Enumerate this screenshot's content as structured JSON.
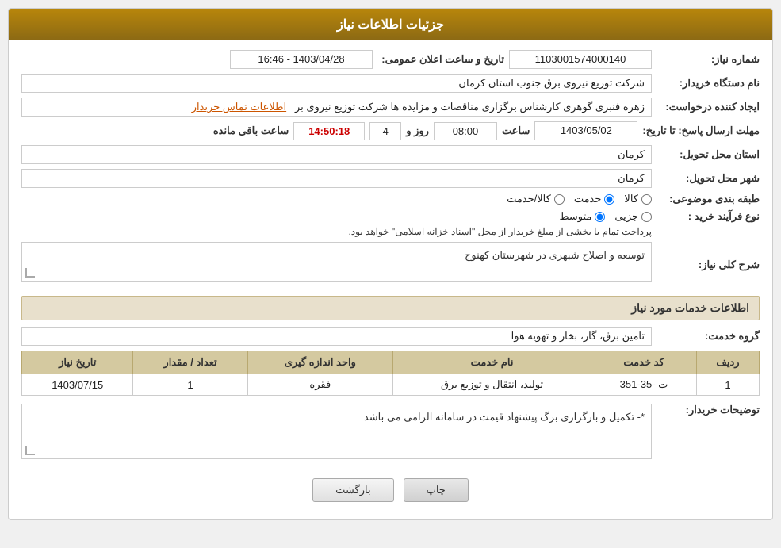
{
  "page": {
    "title": "جزئیات اطلاعات نیاز"
  },
  "header": {
    "shomara_niaz_label": "شماره نیاز:",
    "shomara_niaz_value": "1103001574000140",
    "tarikh_label": "تاریخ و ساعت اعلان عمومی:",
    "tarikh_value": "1403/04/28 - 16:46",
    "nam_dastgah_label": "نام دستگاه خریدار:",
    "nam_dastgah_value": "شرکت توزیع نیروی برق جنوب استان کرمان",
    "ijad_label": "ایجاد کننده درخواست:",
    "ijad_value": "زهره فنبری گوهری کارشناس برگزاری مناقصات و مزایده ها شرکت توزیع نیروی بر",
    "ijad_link": "اطلاعات تماس خریدار",
    "mohlat_label": "مهلت ارسال پاسخ: تا تاریخ:",
    "mohlat_date": "1403/05/02",
    "mohlat_saat_label": "ساعت",
    "mohlat_saat_value": "08:00",
    "mohlat_rooz_label": "روز و",
    "mohlat_rooz_value": "4",
    "mohlat_countdown": "14:50:18",
    "mohlat_baqi_label": "ساعت باقی مانده",
    "ostan_label": "استان محل تحویل:",
    "ostan_value": "کرمان",
    "shahr_label": "شهر محل تحویل:",
    "shahr_value": "کرمان",
    "tabaqe_label": "طبقه بندی موضوعی:",
    "tabaqe_options": [
      {
        "id": "kala",
        "label": "کالا",
        "checked": false
      },
      {
        "id": "khadamat",
        "label": "خدمت",
        "checked": true
      },
      {
        "id": "kala_khadamat",
        "label": "کالا/خدمت",
        "checked": false
      }
    ],
    "noe_farayand_label": "نوع فرآیند خرید :",
    "noe_farayand_options": [
      {
        "id": "jozyi",
        "label": "جزیی",
        "checked": false
      },
      {
        "id": "motavasset",
        "label": "متوسط",
        "checked": true
      }
    ],
    "noe_farayand_desc": "پرداخت تمام یا بخشی از مبلغ خریدار از محل \"اسناد خزانه اسلامی\" خواهد بود.",
    "sharh_label": "شرح کلی نیاز:",
    "sharh_value": "توسعه و اصلاح شبهری در شهرستان کهنوج"
  },
  "khadamat_section": {
    "title": "اطلاعات خدمات مورد نیاز",
    "grooh_label": "گروه خدمت:",
    "grooh_value": "تامین برق، گاز، بخار و تهویه هوا",
    "table": {
      "columns": [
        "ردیف",
        "کد خدمت",
        "نام خدمت",
        "واحد اندازه گیری",
        "تعداد / مقدار",
        "تاریخ نیاز"
      ],
      "rows": [
        {
          "radif": "1",
          "kod": "ت -35-351",
          "nam": "تولید، انتقال و توزیع برق",
          "vahed": "فقره",
          "tedad": "1",
          "tarikh": "1403/07/15"
        }
      ]
    }
  },
  "toseih": {
    "label": "توضیحات خریدار:",
    "value": "*- تکمیل و بارگزاری برگ پیشنهاد قیمت در سامانه الزامی می باشد"
  },
  "buttons": {
    "print": "چاپ",
    "back": "بازگشت"
  }
}
